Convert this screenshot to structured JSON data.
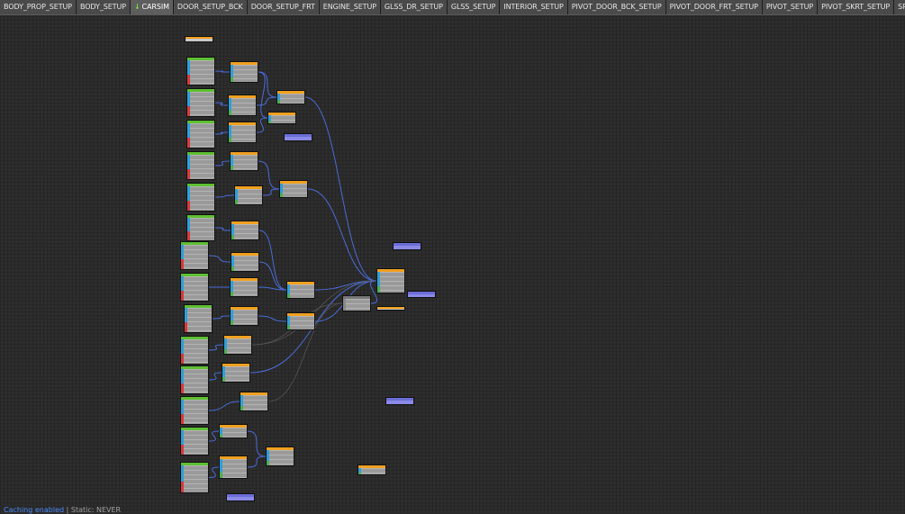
{
  "tabs": [
    {
      "label": "BODY_PROP_SETUP"
    },
    {
      "label": "BODY_SETUP"
    },
    {
      "label": "CARSIM",
      "active": true
    },
    {
      "label": "DOOR_SETUP_BCK"
    },
    {
      "label": "DOOR_SETUP_FRT"
    },
    {
      "label": "ENGINE_SETUP"
    },
    {
      "label": "GLSS_DR_SETUP"
    },
    {
      "label": "GLSS_SETUP"
    },
    {
      "label": "INTERIOR_SETUP"
    },
    {
      "label": "PIVOT_DOOR_BCK_SETUP"
    },
    {
      "label": "PIVOT_DOOR_FRT_SETUP"
    },
    {
      "label": "PIVOT_SETUP"
    },
    {
      "label": "PIVOT_SKRT_SETUP"
    },
    {
      "label": "SRK_SETUP"
    }
  ],
  "status": {
    "caching": "Caching enabled",
    "separator": " | ",
    "static": "Static: NEVER"
  },
  "colors": {
    "source_header": "#5fbf33",
    "operator_header": "#f0a020",
    "label_node": "#8a8ae6",
    "wire": "#4a6cd8",
    "canvas": "#2e2e2e"
  },
  "icons": {
    "active_tab": "green-down-arrow-icon"
  }
}
